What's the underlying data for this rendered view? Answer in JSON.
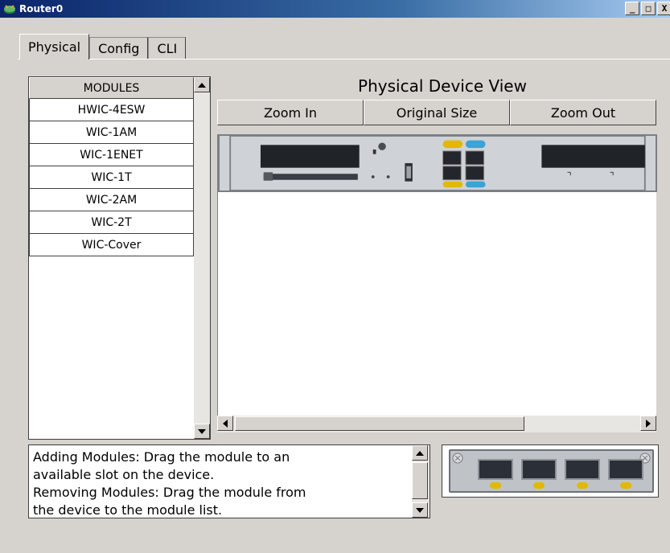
{
  "window": {
    "title": "Router0",
    "buttons": {
      "minimize": "_",
      "maximize": "□",
      "close": "X"
    }
  },
  "tabs": [
    {
      "label": "Physical",
      "active": true
    },
    {
      "label": "Config",
      "active": false
    },
    {
      "label": "CLI",
      "active": false
    }
  ],
  "modules": {
    "header": "MODULES",
    "items": [
      "HWIC-4ESW",
      "WIC-1AM",
      "WIC-1ENET",
      "WIC-1T",
      "WIC-2AM",
      "WIC-2T",
      "WIC-Cover"
    ]
  },
  "device_view": {
    "title": "Physical Device View",
    "zoom_in": "Zoom In",
    "original_size": "Original Size",
    "zoom_out": "Zoom Out"
  },
  "info": {
    "line1": "Adding Modules: Drag the module to an",
    "line2": " available slot on the device.",
    "line3": "Removing Modules: Drag the module from",
    "line4": " the device to the module list."
  },
  "colors": {
    "titlebar_start": "#0a246a",
    "titlebar_end": "#a6caf0",
    "face": "#d6d3ce",
    "led": "#e2b900"
  }
}
